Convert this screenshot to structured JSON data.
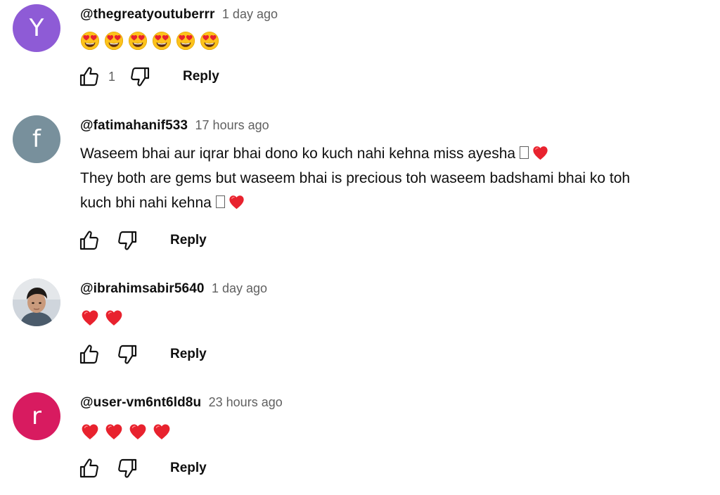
{
  "comments": [
    {
      "author": "@thegreatyoutuberrr",
      "time": "1 day ago",
      "avatar_letter": "Y",
      "avatar_color": "#8e5bd6",
      "emoji": [
        "heart-eyes-emoji",
        "heart-eyes-emoji",
        "heart-eyes-emoji",
        "heart-eyes-emoji",
        "heart-eyes-emoji",
        "heart-eyes-emoji"
      ],
      "likes": "1",
      "reply_label": "Reply"
    },
    {
      "author": "@fatimahanif533",
      "time": "17 hours ago",
      "avatar_letter": "f",
      "avatar_color": "#78909c",
      "lines": [
        "Waseem bhai aur iqrar bhai dono ko kuch nahi kehna miss ayesha",
        "They both are gems but waseem bhai is precious toh waseem badshami bhai ko toh",
        "kuch bhi nahi kehna"
      ],
      "reply_label": "Reply"
    },
    {
      "author": "@ibrahimsabir5640",
      "time": "1 day ago",
      "avatar_type": "photo",
      "emoji": [
        "red-heart-emoji",
        "red-heart-emoji"
      ],
      "reply_label": "Reply"
    },
    {
      "author": "@user-vm6nt6ld8u",
      "time": "23 hours ago",
      "avatar_letter": "r",
      "avatar_color": "#d81b60",
      "emoji": [
        "red-heart-emoji",
        "red-heart-emoji",
        "red-heart-emoji",
        "red-heart-emoji"
      ],
      "reply_label": "Reply"
    }
  ],
  "icons": {
    "like": "thumbs-up-icon",
    "dislike": "thumbs-down-icon"
  }
}
